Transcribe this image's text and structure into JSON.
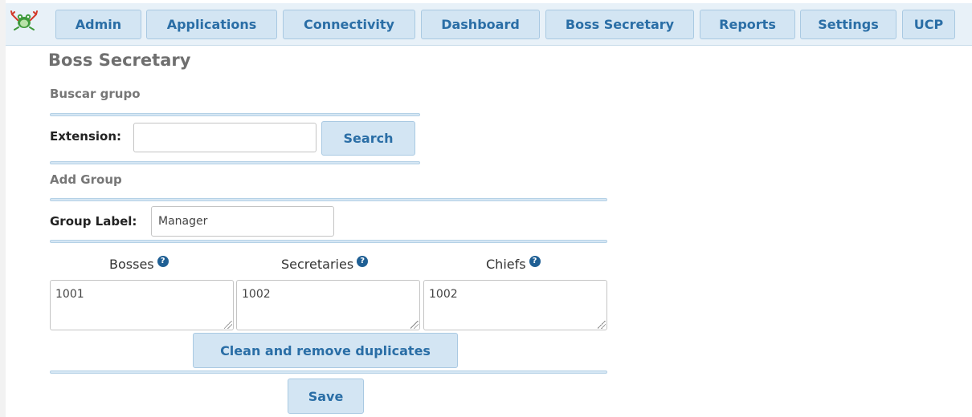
{
  "nav": {
    "items": [
      {
        "label": "Admin"
      },
      {
        "label": "Applications"
      },
      {
        "label": "Connectivity"
      },
      {
        "label": "Dashboard"
      },
      {
        "label": "Boss Secretary"
      },
      {
        "label": "Reports"
      },
      {
        "label": "Settings"
      },
      {
        "label": "UCP"
      }
    ]
  },
  "page": {
    "title": "Boss Secretary"
  },
  "search": {
    "section_title": "Buscar grupo",
    "extension_label": "Extension:",
    "extension_value": "",
    "button_label": "Search"
  },
  "add_group": {
    "section_title": "Add Group",
    "group_label": "Group Label:",
    "group_label_value": "Manager",
    "columns": [
      {
        "label": "Bosses",
        "value": "1001"
      },
      {
        "label": "Secretaries",
        "value": "1002"
      },
      {
        "label": "Chiefs",
        "value": "1002"
      }
    ],
    "help_glyph": "?",
    "clean_button_label": "Clean and remove duplicates",
    "save_button_label": "Save"
  },
  "icons": {
    "logo": "frog-logo-icon",
    "help": "help-circle-icon"
  },
  "colors": {
    "accent": "#2a6ea6",
    "button_bg": "#d3e5f3",
    "nav_bg": "#e8f1f8",
    "help_icon": "#1f5f94"
  }
}
